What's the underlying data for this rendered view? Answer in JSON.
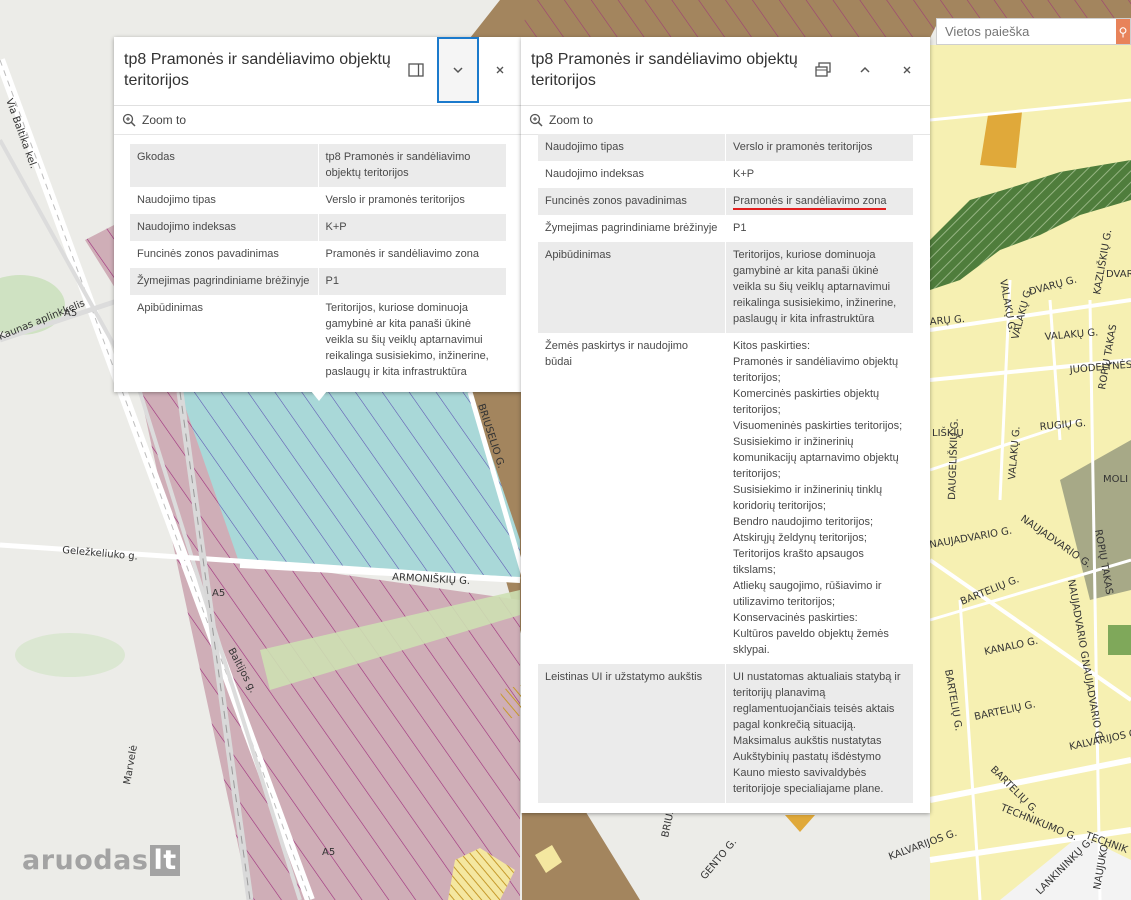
{
  "search": {
    "placeholder": "Vietos paieška"
  },
  "popup_left": {
    "title": "tp8 Pramonės ir sandėliavimo objektų teritorijos",
    "dock_icon": "dock-icon",
    "collapse_icon": "chevron-down-icon",
    "close_icon": "close-icon",
    "zoom_label": "Zoom to",
    "rows": [
      {
        "key": "Gkodas",
        "value": "tp8 Pramonės ir sandėliavimo objektų teritorijos"
      },
      {
        "key": "Naudojimo tipas",
        "value": "Verslo ir pramonės teritorijos"
      },
      {
        "key": "Naudojimo indeksas",
        "value": "K+P"
      },
      {
        "key": "Funcinės zonos pavadinimas",
        "value": "Pramonės ir sandėliavimo zona"
      },
      {
        "key": "Žymejimas pagrindiniame brėžinyje",
        "value": "P1"
      },
      {
        "key": "Apibūdinimas",
        "value": "Teritorijos, kuriose dominuoja gamybinė ar kita panaši ūkinė veikla su šių veiklų aptarnavimui reikalinga susisiekimo, inžinerine, paslaugų ir kita infrastruktūra"
      }
    ]
  },
  "popup_right": {
    "title": "tp8 Pramonės ir sandėliavimo objektų teritorijos",
    "undock_icon": "undock-icon",
    "expand_icon": "chevron-up-icon",
    "close_icon": "close-icon",
    "zoom_label": "Zoom to",
    "rows": [
      {
        "key": "Naudojimo tipas",
        "value": "Verslo ir pramonės teritorijos"
      },
      {
        "key": "Naudojimo indeksas",
        "value": "K+P"
      },
      {
        "key": "Funcinės zonos pavadinimas",
        "value": "Pramonės ir sandėliavimo zona"
      },
      {
        "key": "Žymejimas pagrindiniame brėžinyje",
        "value": "P1"
      },
      {
        "key": "Apibūdinimas",
        "value": "Teritorijos, kuriose dominuoja gamybinė ar kita panaši ūkinė veikla su šių veiklų aptarnavimui reikalinga susisiekimo, inžinerine, paslaugų ir kita infrastruktūra"
      },
      {
        "key": "Žemės paskirtys ir naudojimo būdai",
        "value": "Kitos paskirties:\nPramonės ir sandėliavimo objektų teritorijos;\nKomercinės paskirties objektų teritorijos;\nVisuomeninės paskirties teritorijos;\nSusisiekimo ir inžinerinių komunikacijų aptarnavimo objektų teritorijos;\nSusisiekimo ir inžinerinių tinklų koridorių teritorijos;\nBendro naudojimo teritorijos;\nAtskirųjų želdynų teritorijos;\nTeritorijos krašto apsaugos tikslams;\nAtliekų saugojimo, rūšiavimo ir utilizavimo teritorijos;\nKonservacinės paskirties:\nKultūros paveldo objektų žemės sklypai."
      },
      {
        "key": "Leistinas UI ir užstatymo aukštis",
        "value": "UI nustatomas aktualiais statybą ir teritorijų planavimą reglamentuojančiais teisės aktais pagal konkrečią situaciją.\nMaksimalus aukštis nustatytas Aukštybinių pastatų išdėstymo Kauno miesto savivaldybės teritorijoje specialiajame plane."
      }
    ]
  },
  "map_labels": {
    "armoniskiu": "ARMONIŠKIŲ G.",
    "bruselio": "BRIUSELIO G.",
    "bruselio2": "BRIUSELIO G.",
    "gelezkeliuko": "Geležkeliuko g.",
    "baltijos": "Baltijos g.",
    "baltijos_kel": "Via Baltika kel.",
    "aplinkkelis": "Kaunas aplinkkelis",
    "a5a": "A5",
    "a5b": "A5",
    "a5c": "A5",
    "a5d": "A5",
    "marvele": "Marvelė",
    "dvaru": "DVARŲ G.",
    "dvar": "DVAR",
    "varu": "ARŲ G.",
    "valaku": "VALAKŲ G.",
    "valaku2": "VALAKŲ G.",
    "valaku3": "VALAKŲ G.",
    "valaku4": "VALAKŲ G.",
    "kazliskiu": "KAZLIŠKIŲ G.",
    "judvilos": "JUODVILĖS G.",
    "juodelynes": "JUODELYNĖS G.",
    "ropiu": "ROPIŲ TAKAS",
    "ropiu2": "ROPIŲ TAKAS",
    "rugiu": "RUGIŲ G.",
    "liskiu": "LIŠKIŲ",
    "daugeliskiu": "DAUGELIŠKIŲ G.",
    "naujadvario": "NAUJADVARIO G.",
    "naujadvario2": "NAUJADVARIO G.",
    "naujadvario3": "NAUJADVARIO G.",
    "naujadvario4": "NAUJADVARIO G.",
    "barteliu": "BARTELIŲ G.",
    "barteliu2": "BARTELIŲ G.",
    "barteliu3": "BARTELIŲ G.",
    "barteliu4": "BARTELIŲ G.",
    "kanalo": "KANALO G.",
    "kalvarijos": "KALVARIJOS G.",
    "kalvarijos2": "KALVARIJOS G.",
    "technikumo": "TECHNIKUMO G.",
    "technik": "TECHNIK",
    "lankininku": "LANKININKŲ G.",
    "naujuko": "NAUJUKO",
    "moli": "MOLI",
    "gento": "GENTO G."
  },
  "logo": {
    "text": "aruodas",
    "suffix": "lt"
  }
}
